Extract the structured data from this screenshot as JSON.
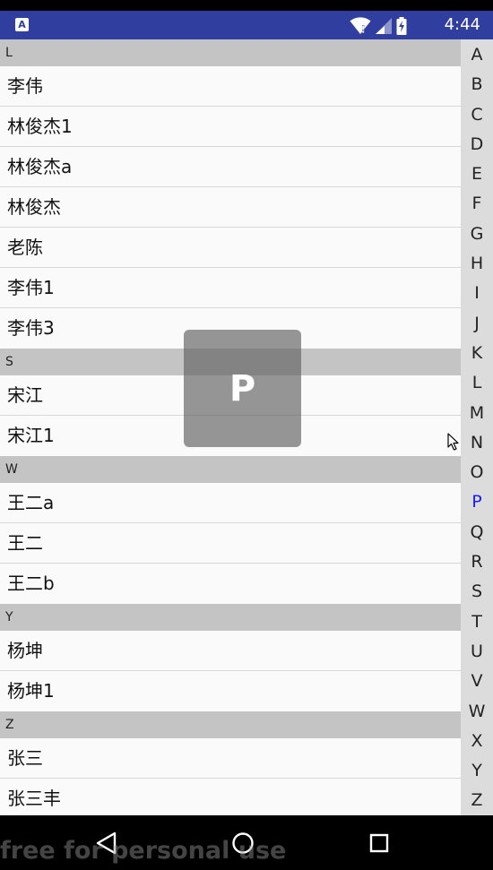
{
  "status_bar": {
    "app_icon": "A",
    "time": "4:44",
    "icons": [
      "wifi-icon",
      "signal-icon",
      "battery-charging-icon"
    ]
  },
  "contacts": {
    "sections": [
      {
        "letter": "L",
        "names": [
          "李伟",
          "林俊杰1",
          "林俊杰a",
          "林俊杰",
          "老陈",
          "李伟1",
          "李伟3"
        ]
      },
      {
        "letter": "S",
        "names": [
          "宋江",
          "宋江1"
        ]
      },
      {
        "letter": "W",
        "names": [
          "王二a",
          "王二",
          "王二b"
        ]
      },
      {
        "letter": "Y",
        "names": [
          "杨坤",
          "杨坤1"
        ]
      },
      {
        "letter": "Z",
        "names": [
          "张三",
          "张三丰"
        ]
      }
    ]
  },
  "index_bar": {
    "letters": [
      "A",
      "B",
      "C",
      "D",
      "E",
      "F",
      "G",
      "H",
      "I",
      "J",
      "K",
      "L",
      "M",
      "N",
      "O",
      "P",
      "Q",
      "R",
      "S",
      "T",
      "U",
      "V",
      "W",
      "X",
      "Y",
      "Z"
    ],
    "active": "P",
    "active_color": "#1a1aff"
  },
  "overlay": {
    "letter": "P"
  },
  "nav_bar": {
    "icons": [
      "back-icon",
      "home-icon",
      "recents-icon"
    ]
  },
  "watermark": {
    "text": "free for personal use"
  },
  "colors": {
    "status_bar": "#303f9f",
    "section_header": "#c4c4c4",
    "index_bar": "#dcdcdc"
  }
}
